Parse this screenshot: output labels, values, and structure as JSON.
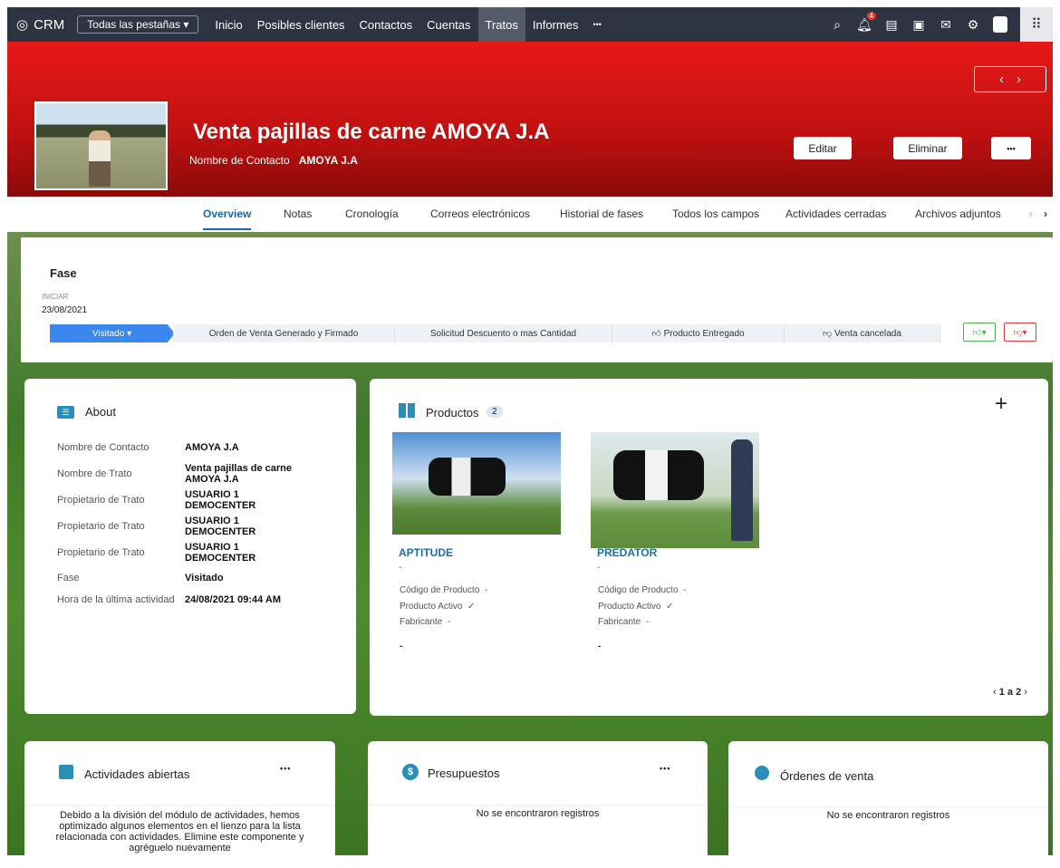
{
  "nav": {
    "brand": "CRM",
    "all_tabs": "Todas las pestañas",
    "items": [
      "Inicio",
      "Posibles clientes",
      "Contactos",
      "Cuentas",
      "Tratos",
      "Informes"
    ],
    "active": "Tratos",
    "more": "•••",
    "notif_count": "4"
  },
  "header": {
    "title": "Venta pajillas de carne AMOYA J.A",
    "contact_label": "Nombre de Contacto",
    "contact_value": "AMOYA J.A",
    "edit": "Editar",
    "delete": "Eliminar",
    "more": "•••"
  },
  "tabs": [
    "Overview",
    "Notas",
    "Cronología",
    "Correos electrónicos",
    "Historial de fases",
    "Todos los campos",
    "Actividades cerradas",
    "Archivos adjuntos"
  ],
  "fase": {
    "title": "Fase",
    "start_label": "INICIAR",
    "start_date": "23/08/2021",
    "stages": [
      "Visitado",
      "Orden de Venta Generado y Firmado",
      "Solicitud Descuento o mas Cantidad",
      "Producto Entregado",
      "Venta cancelada"
    ]
  },
  "about": {
    "title": "About",
    "rows": [
      {
        "label": "Nombre de Contacto",
        "value": "AMOYA J.A"
      },
      {
        "label": "Nombre de Trato",
        "value": "Venta pajillas de carne AMOYA J.A"
      },
      {
        "label": "Propietario de Trato",
        "value": "USUARIO 1 DEMOCENTER"
      },
      {
        "label": "Propietario de Trato",
        "value": "USUARIO 1 DEMOCENTER"
      },
      {
        "label": "Propietario de Trato",
        "value": "USUARIO 1 DEMOCENTER"
      },
      {
        "label": "Fase",
        "value": "Visitado"
      },
      {
        "label": "Hora de la última actividad",
        "value": "24/08/2021 09:44 AM"
      }
    ]
  },
  "products": {
    "title": "Productos",
    "count": "2",
    "pager": "1 a 2",
    "items": [
      {
        "name": "APTITUDE",
        "sub": "-",
        "code_label": "Código de Producto",
        "code": "-",
        "active_label": "Producto Activo",
        "active": "✓",
        "maker_label": "Fabricante",
        "maker": "-",
        "extra": "-"
      },
      {
        "name": "PREDATOR",
        "sub": "-",
        "code_label": "Código de Producto",
        "code": "-",
        "active_label": "Producto Activo",
        "active": "✓",
        "maker_label": "Fabricante",
        "maker": "-",
        "extra": "-"
      }
    ]
  },
  "activities": {
    "title": "Actividades abiertas",
    "more": "•••",
    "message": "Debido a la división del módulo de actividades, hemos optimizado algunos elementos en el lienzo para la lista relacionada con actividades. Elimine este componente y agréguelo nuevamente"
  },
  "quotes": {
    "title": "Presupuestos",
    "more": "•••",
    "empty": "No se encontraron registros"
  },
  "orders": {
    "title": "Órdenes de venta",
    "empty": "No se encontraron registros"
  }
}
